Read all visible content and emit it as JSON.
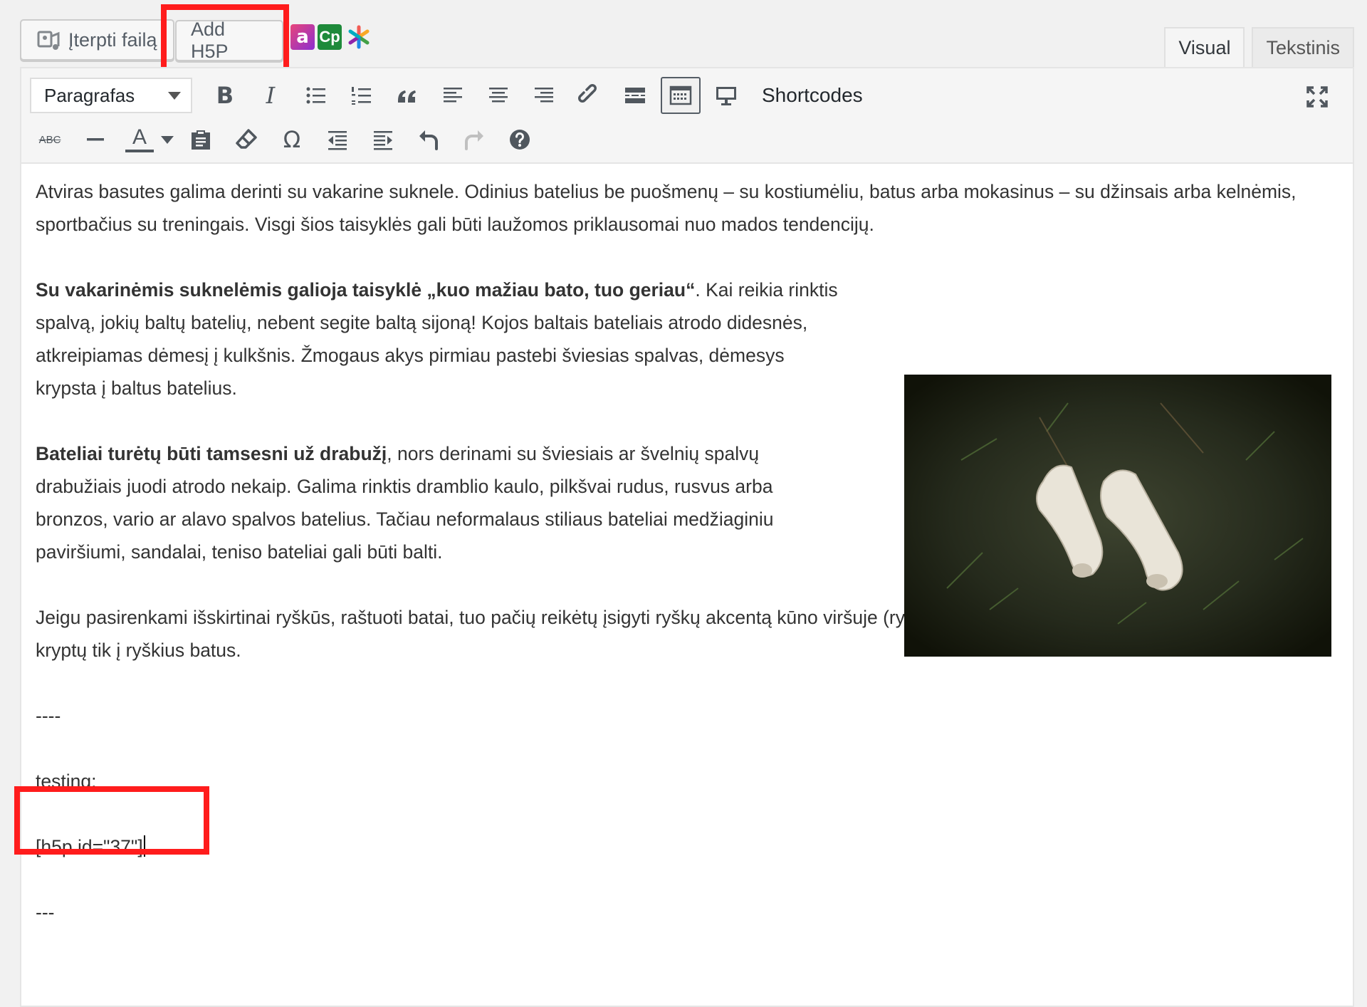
{
  "media_buttons": {
    "insert_file_label": "Įterpti failą",
    "add_h5p_label": "Add H5P",
    "plugin_a_label": "a",
    "plugin_cp_label": "Cp"
  },
  "tabs": [
    {
      "label": "Visual",
      "active": true
    },
    {
      "label": "Tekstinis",
      "active": false
    }
  ],
  "toolbar": {
    "format_select_value": "Paragrafas",
    "shortcodes_label": "Shortcodes",
    "row1_icons": [
      "bold-icon",
      "italic-icon",
      "bullet-list-icon",
      "numbered-list-icon",
      "blockquote-icon",
      "align-left-icon",
      "align-center-icon",
      "align-right-icon",
      "link-icon",
      "read-more-icon",
      "toolbar-toggle-icon",
      "shortcodes-monitor-icon"
    ],
    "row2_icons": [
      "strikethrough-icon",
      "horizontal-line-icon",
      "text-color-icon",
      "paste-text-icon",
      "clear-formatting-icon",
      "special-character-icon",
      "outdent-icon",
      "indent-icon",
      "undo-icon",
      "redo-icon",
      "help-icon"
    ],
    "strikethrough_glyph": "ABC",
    "text_color_glyph": "A",
    "omega_glyph": "Ω",
    "bold_glyph": "B",
    "italic_glyph": "I",
    "quote_glyph": "“"
  },
  "content": {
    "p1": "Atviras basutes galima derinti su vakarine suknele. Odinius batelius be puošmenų – su kostiumėliu, batus arba mokasinus – su džinsais arba kelnėmis, sportbačius su treningais. Visgi šios taisyklės gali būti laužomos priklausomai nuo mados tendencijų.",
    "p2_bold": "Su vakarinėmis suknelėmis galioja taisyklė „kuo mažiau bato, tuo geriau“",
    "p2_rest": ". Kai reikia rinktis spalvą, jokių baltų batelių, nebent segite baltą sijoną! Kojos baltais bateliais atrodo didesnės, atkreipiamas dėmesį į kulkšnis. Žmogaus akys pirmiau pastebi šviesias spalvas, dėmesys krypsta į baltus batelius.",
    "p3_bold": "Bateliai turėtų būti tamsesni už drabužį",
    "p3_rest": ", nors derinami su šviesiais ar švelnių spalvų drabužiais juodi atrodo nekaip. Galima rinktis dramblio kaulo, pilkšvai rudus, rusvus arba bronzos, vario ar alavo spalvos batelius. Tačiau neformalaus stiliaus bateliai medžiaginiu paviršiumi, sandalai, teniso bateliai gali būti balti.",
    "p4": "Jeigu pasirenkami išskirtinai ryškūs, raštuoti batai, tuo pačių reikėtų įsigyti ryškų akcentą kūno viršuje (ryškų šalikėlį ar pan.), kadangi kitu atveju dėmesys kryptų tik į ryškius batus.",
    "separator1": "----",
    "testing": "testing:",
    "shortcode": "[h5p id=\"37\"]",
    "separator2": "---",
    "image_subject": "white-shoes-on-grass"
  },
  "colors": {
    "highlight": "#ff1c1c",
    "spellcheck": "#e0342c"
  }
}
